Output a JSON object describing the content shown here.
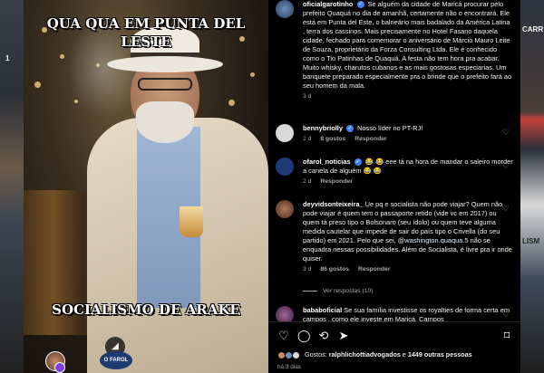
{
  "background": {
    "left_label": "1",
    "right_label": "CARR",
    "right_label_bottom": "LISM"
  },
  "media": {
    "headline_top": "QUA QUA EM PUNTA DEL LESTE",
    "headline_bottom": "SOCIALISMO DE ARAKE",
    "footer_badge": "O FAROL",
    "volume_icon": "volume-icon"
  },
  "post": {
    "author": "oficialgarotinho",
    "text": "Se alguém da cidade de Maricá procurar pelo prefeito Quaquá no dia de amanhã, certamente não o encontrará. Ele está em Punta del Este, o balneário mais badalado da América Latina , terra dos cassinos. Mais precisamente no Hotel Fasano daquela cidade, fechado para comemorar o aniversário de Márcio Mauro Leite de Souza, proprietário da Forza Consulting Ltda. Ele é conhecido como o Tio Patinhas de Quaquá. A festa não tem hora pra acabar. Muito whisky, charutos cubanos e as mais gostosas especiarias. Um banquete preparado especialmente pra o brinde que o prefeito fará ao seu homem da mala.",
    "time": "3 d"
  },
  "comments": [
    {
      "user": "bennybriolly",
      "verified": true,
      "text": "Nosso líder no PT-RJ!",
      "time": "2 d",
      "likes": "8 gostos",
      "reply": "Responder",
      "avatar_color": "#d9d9d9"
    },
    {
      "user": "ofarol_noticias",
      "verified": true,
      "text": "😂 😂 eee tá na hora de mandar o saleiro morder a canela de alguém 😂 😂",
      "time": "2 d",
      "likes": "",
      "reply": "Responder",
      "avatar_color": "#1d3b72"
    },
    {
      "user": "deyvidsonteixeira_",
      "verified": false,
      "text_before": "Ue pq e socialista não pode viajar? Quem não pode viajar é quem tem o passaporte retido (vide vc em 2017) ou quem tá preso tipo o Bolsonaro (seu ídolo) ou quem teve alguma medida cautelar que impede de sair do país tipo o Crivella (do seu partido) em 2021. Pelo que sei, ",
      "mention": "@washington.quaqua.5",
      "text_after": " não se enquadra nessas possibilidades. Além de Socialista, é livre pra ir onde quiser.",
      "time": "3 d",
      "likes": "86 gostos",
      "reply": "Responder",
      "avatar_color": "#7a4a3a",
      "view_replies": "Ver respostas (10)"
    },
    {
      "user": "bababoficial",
      "verified": false,
      "text": "Se sua família investisse os royalties de forma certa em campos , como ele investe em Maricá. Campos",
      "avatar_color": "#5a3a6a"
    }
  ],
  "actions": {
    "likes_label": "Gostos:",
    "likes_users": "ralphlichottiadvogados",
    "likes_connector": "e",
    "likes_count": "1449 outras pessoas",
    "time": "há 3 dias"
  },
  "colors": {
    "verified": "#3b82f6",
    "panel_bg": "#000000",
    "muted": "#a8a8a8"
  }
}
